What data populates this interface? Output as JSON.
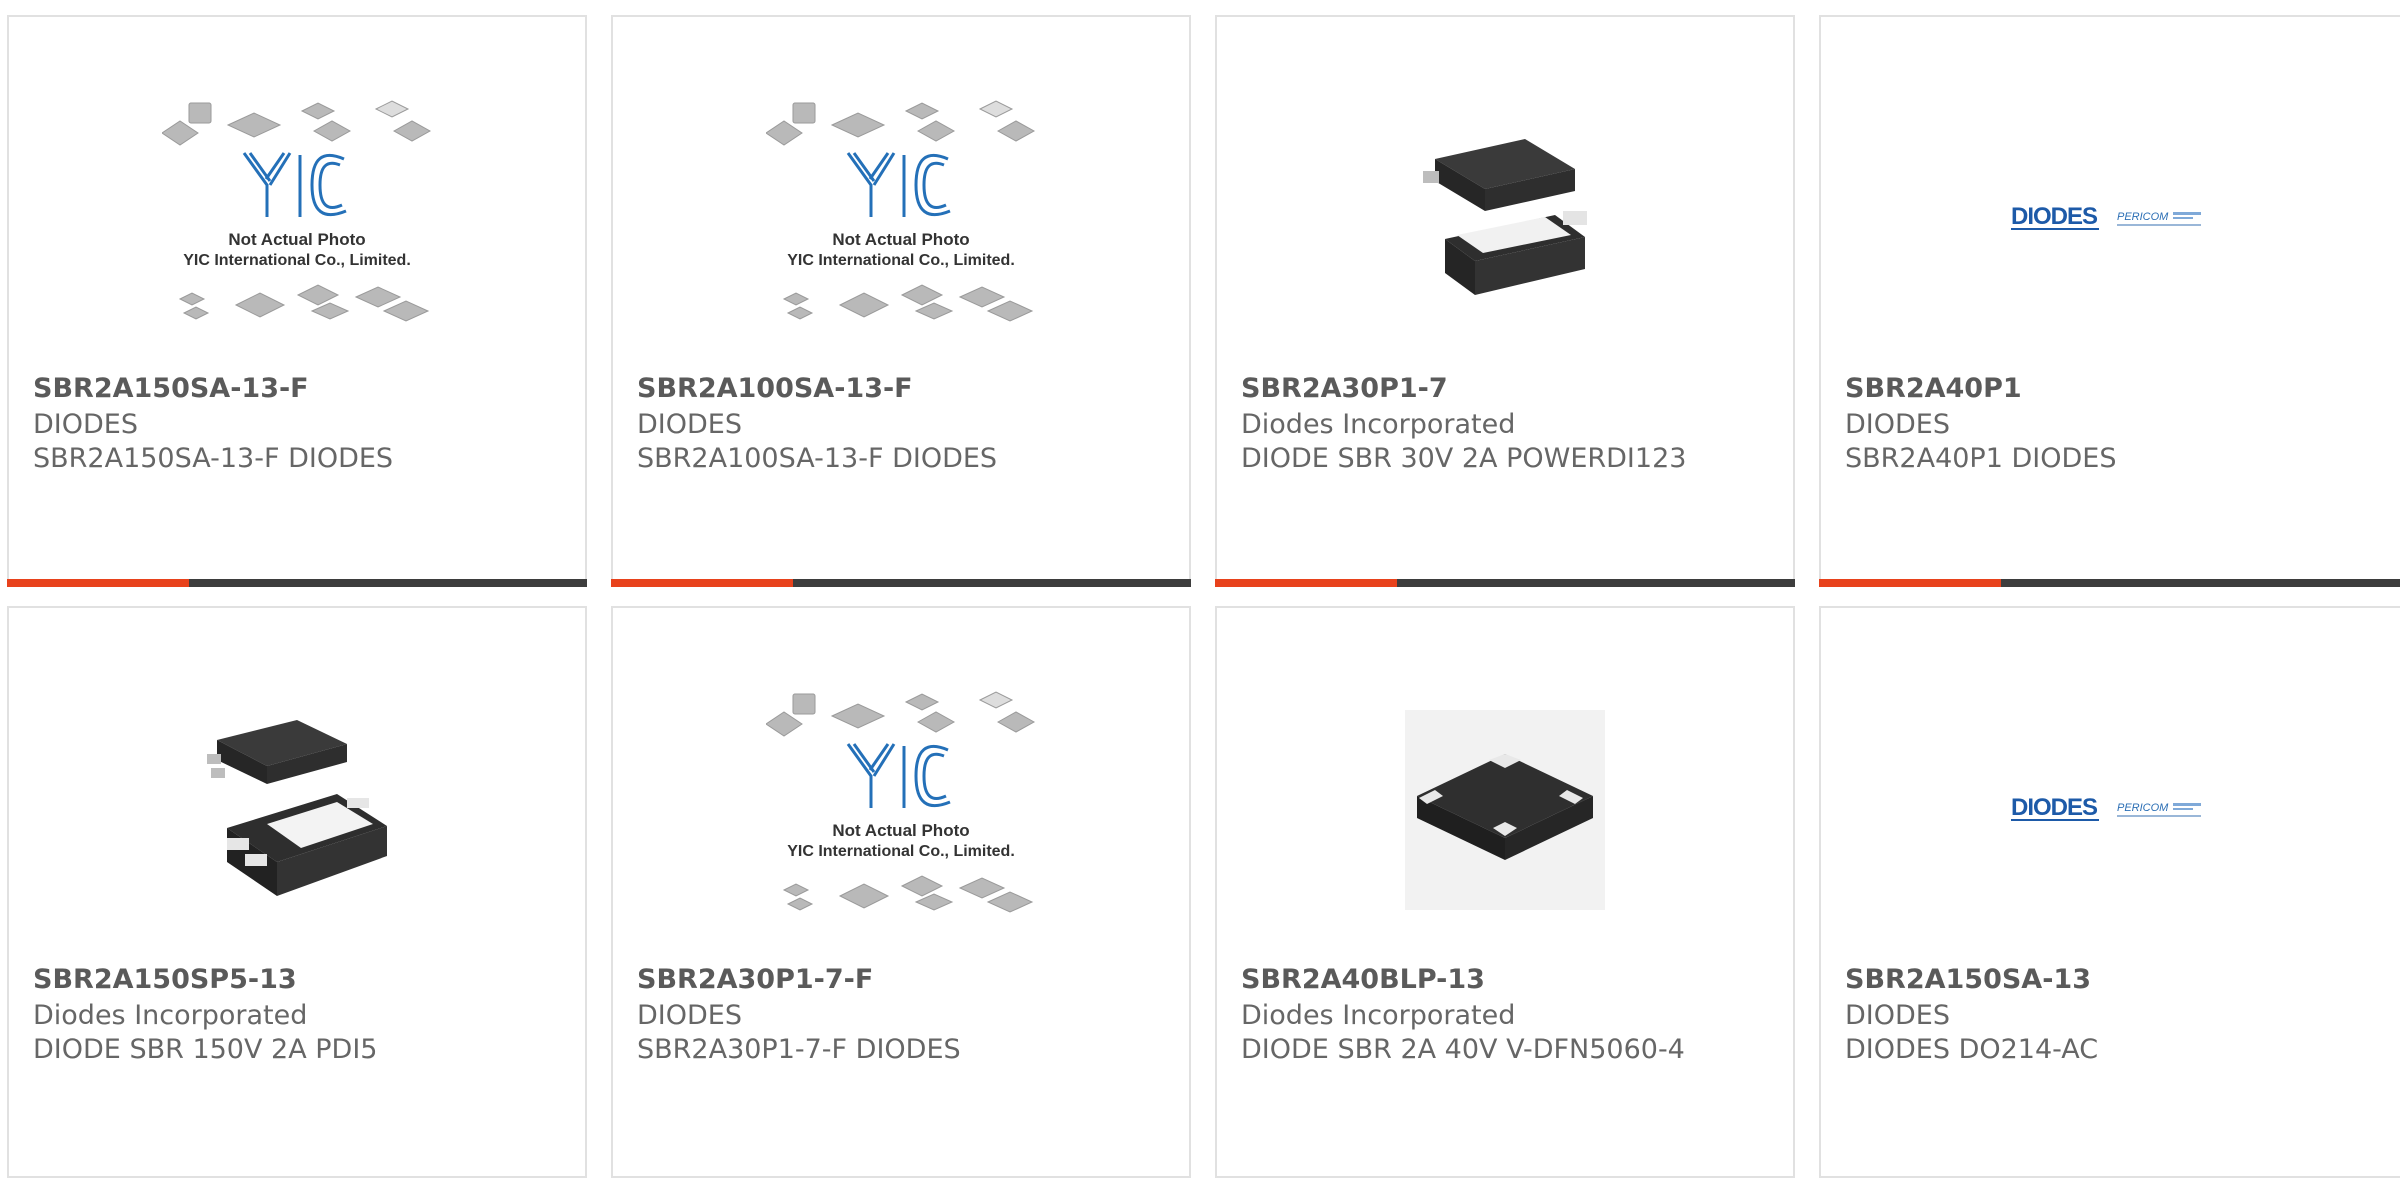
{
  "colors": {
    "accent": "#e8421c",
    "bar": "#3d3d3d",
    "border": "#e1e1e1",
    "text": "#666666"
  },
  "placeholder": {
    "line1": "Not Actual Photo",
    "line2": "YIC International Co., Limited.",
    "logo": "YIC"
  },
  "diodes_logo": {
    "brand": "DIODES",
    "sub": "PERICOM"
  },
  "products": [
    {
      "pn": "SBR2A150SA-13-F",
      "mfr": "DIODES",
      "desc": "SBR2A150SA-13-F DIODES",
      "image": "yic-placeholder"
    },
    {
      "pn": "SBR2A100SA-13-F",
      "mfr": "DIODES",
      "desc": "SBR2A100SA-13-F DIODES",
      "image": "yic-placeholder"
    },
    {
      "pn": "SBR2A30P1-7",
      "mfr": "Diodes Incorporated",
      "desc": "DIODE SBR 30V 2A POWERDI123",
      "image": "powerdi123-package"
    },
    {
      "pn": "SBR2A40P1",
      "mfr": "DIODES",
      "desc": "SBR2A40P1 DIODES",
      "image": "diodes-logo"
    },
    {
      "pn": "SBR2A150SP5-13",
      "mfr": "Diodes Incorporated",
      "desc": "DIODE SBR 150V 2A PDI5",
      "image": "pdi5-package"
    },
    {
      "pn": "SBR2A30P1-7-F",
      "mfr": "DIODES",
      "desc": "SBR2A30P1-7-F DIODES",
      "image": "yic-placeholder"
    },
    {
      "pn": "SBR2A40BLP-13",
      "mfr": "Diodes Incorporated",
      "desc": "DIODE SBR 2A 40V V-DFN5060-4",
      "image": "dfn-package"
    },
    {
      "pn": "SBR2A150SA-13",
      "mfr": "DIODES",
      "desc": "DIODES DO214-AC",
      "image": "diodes-logo"
    }
  ]
}
